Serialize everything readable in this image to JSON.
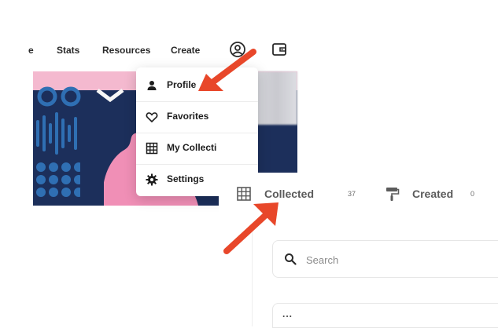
{
  "nav": {
    "partial_label": "e",
    "items": [
      "Stats",
      "Resources",
      "Create"
    ],
    "icons": [
      "account-circle-icon",
      "wallet-icon"
    ]
  },
  "menu": {
    "items": [
      {
        "label": "Profile",
        "icon": "person-icon"
      },
      {
        "label": "Favorites",
        "icon": "heart-icon"
      },
      {
        "label": "My Collecti",
        "icon": "grid-icon"
      },
      {
        "label": "Settings",
        "icon": "gear-icon"
      }
    ]
  },
  "profile": {
    "tabs": [
      {
        "label": "Collected",
        "count": "37",
        "icon": "grid-icon"
      },
      {
        "label": "Created",
        "count": "0",
        "icon": "paint-roller-icon"
      }
    ],
    "search": {
      "placeholder": "Search"
    },
    "more_label": "..."
  },
  "colors": {
    "annotation_arrow": "#e8472a",
    "hero_navy": "#1c2f5b",
    "hero_pink": "#f08fb6",
    "hero_blue": "#2f6fb3"
  }
}
